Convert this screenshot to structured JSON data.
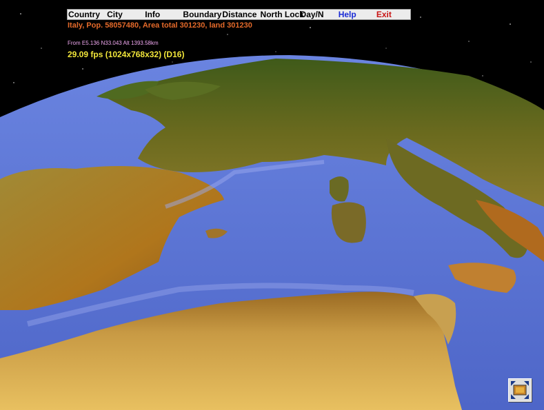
{
  "menu": {
    "items": [
      {
        "label": "Country"
      },
      {
        "label": "City"
      },
      {
        "label": "Info"
      },
      {
        "label": "Boundary"
      },
      {
        "label": "Distance"
      },
      {
        "label": "North Lock"
      },
      {
        "label": "Day/N"
      },
      {
        "label": "Help"
      },
      {
        "label": "Exit"
      }
    ]
  },
  "overlay": {
    "info": "Italy, Pop. 58057480, Area total 301230, land 301230",
    "coords": "From E5.136 N33.043 Alt 1393.58km",
    "fps": "29.09 fps (1024x768x32) (D16)"
  },
  "colors": {
    "sky": "#000000",
    "sea": "#5f79d8",
    "land": "#8c7a2a",
    "info_text": "#e56a2a",
    "fps_text": "#f2e63a",
    "help_text": "#1a2bd6",
    "exit_text": "#c81414"
  },
  "icons": {
    "corner_button": "fullscreen-toggle-icon"
  }
}
